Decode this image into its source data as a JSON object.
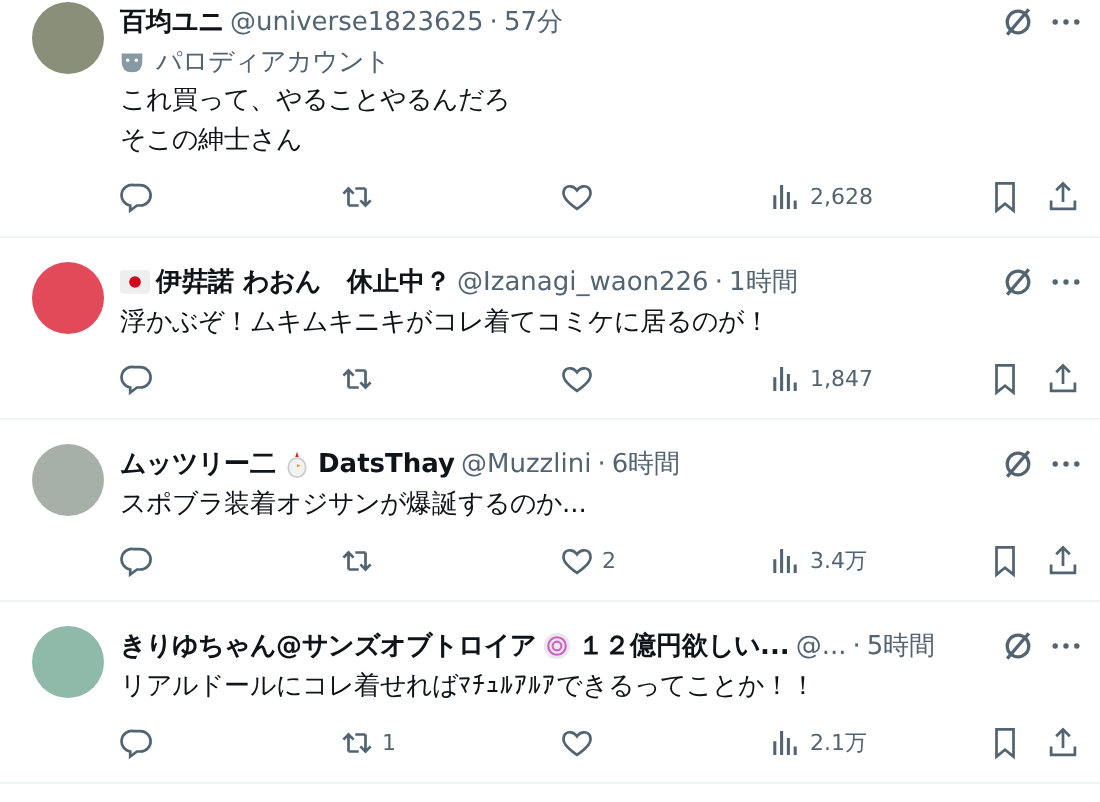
{
  "posts": [
    {
      "name": [
        {
          "kind": "text",
          "text": "百均ユニ"
        }
      ],
      "handle": "@universe1823625",
      "sep": "·",
      "time": "57分",
      "label": "パロディアカウント",
      "text": [
        "これ買って、やることやるんだろ",
        "そこの紳士さん"
      ],
      "views": "2,628"
    },
    {
      "name": [
        {
          "kind": "flag"
        },
        {
          "kind": "text",
          "text": "伊弉諾 わおん　休止中？"
        }
      ],
      "handle": "@Izanagi_waon226",
      "sep": "·",
      "time": "1時間",
      "text": [
        "浮かぶぞ！ムキムキニキがコレ着てコミケに居るのが！"
      ],
      "views": "1,847"
    },
    {
      "name": [
        {
          "kind": "text",
          "text": "ムッツリー二"
        },
        {
          "kind": "chick"
        },
        {
          "kind": "text",
          "text": "DatsThay"
        }
      ],
      "handle": "@Muzzlini",
      "sep": "·",
      "time": "6時間",
      "text": [
        "スポブラ装着オジサンが爆誕するのか..."
      ],
      "likes": "2",
      "views": "3.4万"
    },
    {
      "name": [
        {
          "kind": "text",
          "text": "きりゆちゃん@サンズオブトロイア"
        },
        {
          "kind": "spiral"
        },
        {
          "kind": "text",
          "text": "１２億円欲しい..."
        }
      ],
      "handle": "@...",
      "sep": "·",
      "time": "5時間",
      "text": [
        "リアルドールにコレ着せればﾏﾁｭﾙｱﾙｱできるってことか！！"
      ],
      "reposts": "1",
      "views": "2.1万"
    }
  ]
}
